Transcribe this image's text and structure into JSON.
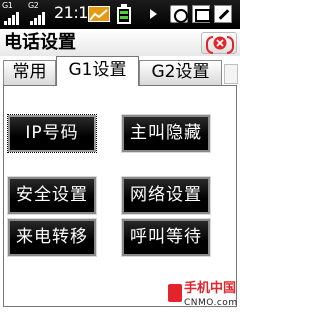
{
  "status_bar": {
    "sim1_label": "G1",
    "sim2_label": "G2",
    "time": "21:12",
    "icons": [
      "signal-g1-icon",
      "signal-g2-icon",
      "chart-icon",
      "battery-icon",
      "play-icon",
      "alarm-icon",
      "sms-icon",
      "edit-icon"
    ]
  },
  "window": {
    "title": "电话设置",
    "close_label": "(⊗)"
  },
  "tabs": [
    {
      "label": "常用",
      "selected": false
    },
    {
      "label": "G1设置",
      "selected": true
    },
    {
      "label": "G2设置",
      "selected": false
    }
  ],
  "actions": [
    {
      "label": "IP号码"
    },
    {
      "label": "主叫隐藏"
    },
    {
      "label": "安全设置"
    },
    {
      "label": "网络设置"
    },
    {
      "label": "来电转移"
    },
    {
      "label": "呼叫等待"
    }
  ],
  "watermark": {
    "name_cn": "手机中国",
    "name_en": "CNMO.com"
  },
  "colors": {
    "status_bar": "#000000",
    "accent_red": "#e3242b",
    "button_bg": "#000000",
    "button_text": "#ffffff"
  }
}
